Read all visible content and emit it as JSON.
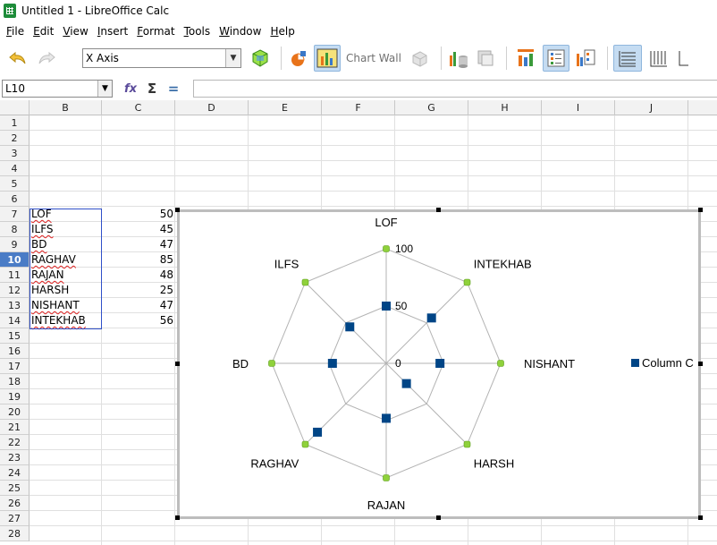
{
  "window": {
    "title": "Untitled 1 - LibreOffice Calc"
  },
  "menu": [
    {
      "label": "File",
      "u": "F",
      "rest": "ile"
    },
    {
      "label": "Edit",
      "u": "E",
      "rest": "dit"
    },
    {
      "label": "View",
      "u": "V",
      "rest": "iew"
    },
    {
      "label": "Insert",
      "u": "I",
      "rest": "nsert"
    },
    {
      "label": "Format",
      "u": "F",
      "rest": "ormat"
    },
    {
      "label": "Tools",
      "u": "T",
      "rest": "ools"
    },
    {
      "label": "Window",
      "u": "W",
      "rest": "indow"
    },
    {
      "label": "Help",
      "u": "H",
      "rest": "elp"
    }
  ],
  "toolbar": {
    "element_select": "X Axis",
    "chart_wall_label": "Chart Wall",
    "icons": [
      "undo-icon",
      "redo-icon",
      "format-selection-icon",
      "chart-type-icon",
      "chart-area-icon",
      "chart-wall-icon",
      "chart-3d-view-icon",
      "data-table-icon",
      "data-ranges-icon",
      "insert-titles-icon",
      "legend-on-off-icon",
      "insert-legend-icon",
      "horizontal-grids-icon",
      "vertical-grids-icon",
      "show-hide-axis-icon"
    ]
  },
  "formula": {
    "name_box": "L10",
    "fx_icon": "function-wizard-icon",
    "sum_icon": "sum-icon",
    "eq_icon": "formula-icon",
    "value": ""
  },
  "sheet": {
    "columns": [
      "B",
      "C",
      "D",
      "E",
      "F",
      "G",
      "H",
      "I",
      "J"
    ],
    "rows": [
      "1",
      "2",
      "3",
      "4",
      "5",
      "6",
      "7",
      "8",
      "9",
      "10",
      "11",
      "12",
      "13",
      "14",
      "15",
      "16",
      "17",
      "18",
      "19",
      "20",
      "21",
      "22",
      "23",
      "24",
      "25",
      "26",
      "27",
      "28"
    ],
    "active_row": "10",
    "data": [
      {
        "name": "LOF",
        "value": "50"
      },
      {
        "name": "ILFS",
        "value": "45"
      },
      {
        "name": "BD",
        "value": "47"
      },
      {
        "name": "RAGHAV",
        "value": "85"
      },
      {
        "name": "RAJAN",
        "value": "48"
      },
      {
        "name": "HARSH",
        "value": "25"
      },
      {
        "name": "NISHANT",
        "value": "47"
      },
      {
        "name": "INTEKHAB",
        "value": "56"
      }
    ]
  },
  "chart_data": {
    "type": "radar",
    "categories": [
      "LOF",
      "ILFS",
      "BD",
      "RAGHAV",
      "RAJAN",
      "HARSH",
      "NISHANT",
      "INTEKHAB"
    ],
    "series": [
      {
        "name": "Column C",
        "values": [
          50,
          45,
          47,
          85,
          48,
          25,
          47,
          56
        ]
      }
    ],
    "rlim": [
      0,
      100
    ],
    "ticks": [
      "0",
      "50",
      "100"
    ],
    "legend": "right",
    "grid": true,
    "colors": {
      "series": "#004586",
      "vertex": "#8fd13b",
      "grid": "#b3b3b3"
    }
  }
}
